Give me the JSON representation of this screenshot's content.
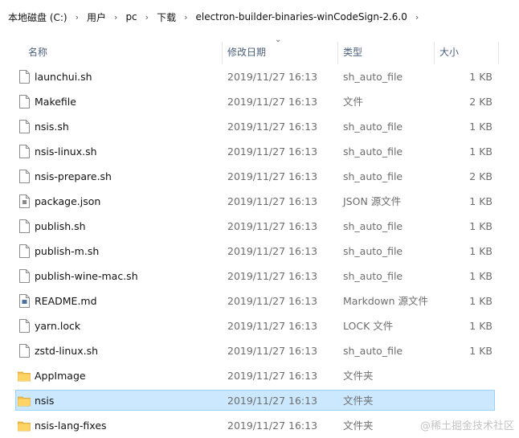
{
  "breadcrumb": [
    "本地磁盘 (C:)",
    "用户",
    "pc",
    "下载",
    "electron-builder-binaries-winCodeSign-2.6.0"
  ],
  "columns": {
    "name": "名称",
    "date": "修改日期",
    "type": "类型",
    "size": "大小"
  },
  "rows": [
    {
      "name": "launchui.sh",
      "date": "2019/11/27 16:13",
      "type": "sh_auto_file",
      "size": "1 KB",
      "icon": "file-icon"
    },
    {
      "name": "Makefile",
      "date": "2019/11/27 16:13",
      "type": "文件",
      "size": "2 KB",
      "icon": "file-icon"
    },
    {
      "name": "nsis.sh",
      "date": "2019/11/27 16:13",
      "type": "sh_auto_file",
      "size": "1 KB",
      "icon": "file-icon"
    },
    {
      "name": "nsis-linux.sh",
      "date": "2019/11/27 16:13",
      "type": "sh_auto_file",
      "size": "1 KB",
      "icon": "file-icon"
    },
    {
      "name": "nsis-prepare.sh",
      "date": "2019/11/27 16:13",
      "type": "sh_auto_file",
      "size": "2 KB",
      "icon": "file-icon"
    },
    {
      "name": "package.json",
      "date": "2019/11/27 16:13",
      "type": "JSON 源文件",
      "size": "1 KB",
      "icon": "json-file-icon"
    },
    {
      "name": "publish.sh",
      "date": "2019/11/27 16:13",
      "type": "sh_auto_file",
      "size": "1 KB",
      "icon": "file-icon"
    },
    {
      "name": "publish-m.sh",
      "date": "2019/11/27 16:13",
      "type": "sh_auto_file",
      "size": "1 KB",
      "icon": "file-icon"
    },
    {
      "name": "publish-wine-mac.sh",
      "date": "2019/11/27 16:13",
      "type": "sh_auto_file",
      "size": "1 KB",
      "icon": "file-icon"
    },
    {
      "name": "README.md",
      "date": "2019/11/27 16:13",
      "type": "Markdown 源文件",
      "size": "1 KB",
      "icon": "markdown-file-icon"
    },
    {
      "name": "yarn.lock",
      "date": "2019/11/27 16:13",
      "type": "LOCK 文件",
      "size": "1 KB",
      "icon": "file-icon"
    },
    {
      "name": "zstd-linux.sh",
      "date": "2019/11/27 16:13",
      "type": "sh_auto_file",
      "size": "1 KB",
      "icon": "file-icon"
    },
    {
      "name": "AppImage",
      "date": "2019/11/27 16:13",
      "type": "文件夹",
      "size": "",
      "icon": "folder-icon"
    },
    {
      "name": "nsis",
      "date": "2019/11/27 16:13",
      "type": "文件夹",
      "size": "",
      "icon": "folder-icon",
      "selected": true
    },
    {
      "name": "nsis-lang-fixes",
      "date": "2019/11/27 16:13",
      "type": "文件夹",
      "size": "",
      "icon": "folder-icon"
    }
  ],
  "watermark": "@稀土掘金技术社区",
  "colors": {
    "selection_bg": "#cce8ff",
    "selection_border": "#99d1ff",
    "folder": "#f5c04a",
    "header_text": "#4c607a"
  }
}
